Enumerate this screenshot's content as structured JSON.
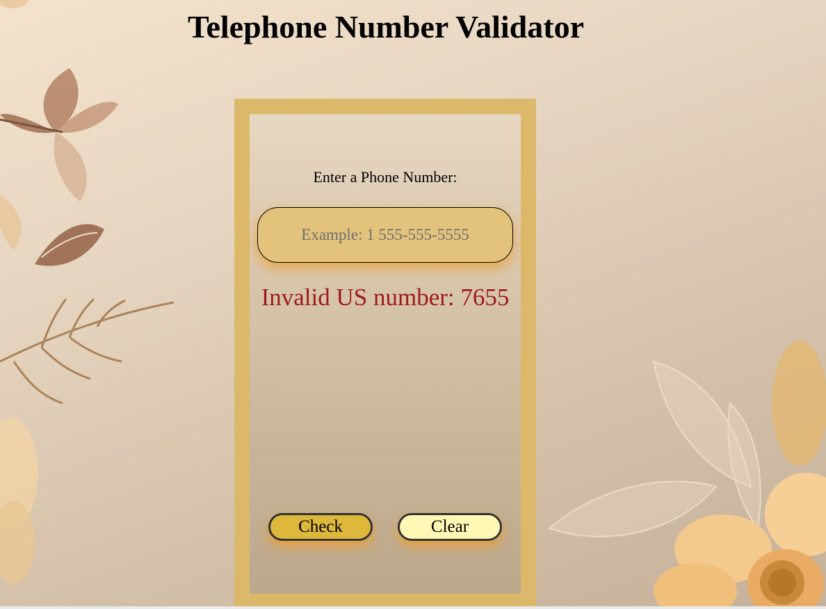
{
  "page": {
    "title": "Telephone Number Validator"
  },
  "form": {
    "label": "Enter a Phone Number:",
    "input_value": "",
    "input_placeholder": "Example: 1 555-555-5555",
    "result_message": "Invalid US number: 7655",
    "check_label": "Check",
    "clear_label": "Clear"
  },
  "colors": {
    "frame": "#dcb96a",
    "input_background": "#e3c27c",
    "check_button": "#ddb83a",
    "clear_button": "#fff8b5",
    "error_text": "#a01a1a",
    "glow": "#ee9c28"
  },
  "decorations": [
    "floral-branch-left",
    "leaf-sprig-left",
    "golden-flower-bottom-right",
    "leaf-outline-bottom-right"
  ]
}
